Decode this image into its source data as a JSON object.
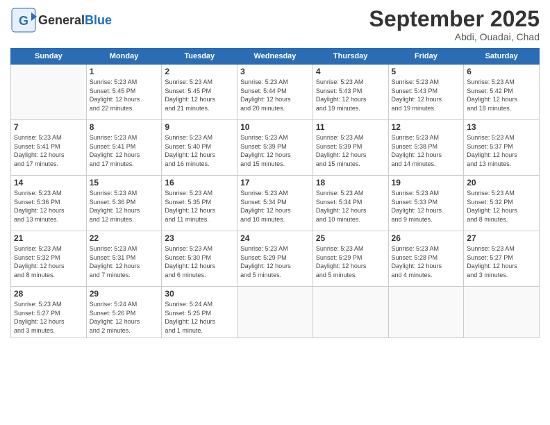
{
  "header": {
    "logo_general": "General",
    "logo_blue": "Blue",
    "month_title": "September 2025",
    "subtitle": "Abdi, Ouadai, Chad"
  },
  "days_of_week": [
    "Sunday",
    "Monday",
    "Tuesday",
    "Wednesday",
    "Thursday",
    "Friday",
    "Saturday"
  ],
  "weeks": [
    [
      {
        "day": "",
        "info": ""
      },
      {
        "day": "1",
        "info": "Sunrise: 5:23 AM\nSunset: 5:45 PM\nDaylight: 12 hours\nand 22 minutes."
      },
      {
        "day": "2",
        "info": "Sunrise: 5:23 AM\nSunset: 5:45 PM\nDaylight: 12 hours\nand 21 minutes."
      },
      {
        "day": "3",
        "info": "Sunrise: 5:23 AM\nSunset: 5:44 PM\nDaylight: 12 hours\nand 20 minutes."
      },
      {
        "day": "4",
        "info": "Sunrise: 5:23 AM\nSunset: 5:43 PM\nDaylight: 12 hours\nand 19 minutes."
      },
      {
        "day": "5",
        "info": "Sunrise: 5:23 AM\nSunset: 5:43 PM\nDaylight: 12 hours\nand 19 minutes."
      },
      {
        "day": "6",
        "info": "Sunrise: 5:23 AM\nSunset: 5:42 PM\nDaylight: 12 hours\nand 18 minutes."
      }
    ],
    [
      {
        "day": "7",
        "info": "Sunrise: 5:23 AM\nSunset: 5:41 PM\nDaylight: 12 hours\nand 17 minutes."
      },
      {
        "day": "8",
        "info": "Sunrise: 5:23 AM\nSunset: 5:41 PM\nDaylight: 12 hours\nand 17 minutes."
      },
      {
        "day": "9",
        "info": "Sunrise: 5:23 AM\nSunset: 5:40 PM\nDaylight: 12 hours\nand 16 minutes."
      },
      {
        "day": "10",
        "info": "Sunrise: 5:23 AM\nSunset: 5:39 PM\nDaylight: 12 hours\nand 15 minutes."
      },
      {
        "day": "11",
        "info": "Sunrise: 5:23 AM\nSunset: 5:39 PM\nDaylight: 12 hours\nand 15 minutes."
      },
      {
        "day": "12",
        "info": "Sunrise: 5:23 AM\nSunset: 5:38 PM\nDaylight: 12 hours\nand 14 minutes."
      },
      {
        "day": "13",
        "info": "Sunrise: 5:23 AM\nSunset: 5:37 PM\nDaylight: 12 hours\nand 13 minutes."
      }
    ],
    [
      {
        "day": "14",
        "info": "Sunrise: 5:23 AM\nSunset: 5:36 PM\nDaylight: 12 hours\nand 13 minutes."
      },
      {
        "day": "15",
        "info": "Sunrise: 5:23 AM\nSunset: 5:36 PM\nDaylight: 12 hours\nand 12 minutes."
      },
      {
        "day": "16",
        "info": "Sunrise: 5:23 AM\nSunset: 5:35 PM\nDaylight: 12 hours\nand 11 minutes."
      },
      {
        "day": "17",
        "info": "Sunrise: 5:23 AM\nSunset: 5:34 PM\nDaylight: 12 hours\nand 10 minutes."
      },
      {
        "day": "18",
        "info": "Sunrise: 5:23 AM\nSunset: 5:34 PM\nDaylight: 12 hours\nand 10 minutes."
      },
      {
        "day": "19",
        "info": "Sunrise: 5:23 AM\nSunset: 5:33 PM\nDaylight: 12 hours\nand 9 minutes."
      },
      {
        "day": "20",
        "info": "Sunrise: 5:23 AM\nSunset: 5:32 PM\nDaylight: 12 hours\nand 8 minutes."
      }
    ],
    [
      {
        "day": "21",
        "info": "Sunrise: 5:23 AM\nSunset: 5:32 PM\nDaylight: 12 hours\nand 8 minutes."
      },
      {
        "day": "22",
        "info": "Sunrise: 5:23 AM\nSunset: 5:31 PM\nDaylight: 12 hours\nand 7 minutes."
      },
      {
        "day": "23",
        "info": "Sunrise: 5:23 AM\nSunset: 5:30 PM\nDaylight: 12 hours\nand 6 minutes."
      },
      {
        "day": "24",
        "info": "Sunrise: 5:23 AM\nSunset: 5:29 PM\nDaylight: 12 hours\nand 5 minutes."
      },
      {
        "day": "25",
        "info": "Sunrise: 5:23 AM\nSunset: 5:29 PM\nDaylight: 12 hours\nand 5 minutes."
      },
      {
        "day": "26",
        "info": "Sunrise: 5:23 AM\nSunset: 5:28 PM\nDaylight: 12 hours\nand 4 minutes."
      },
      {
        "day": "27",
        "info": "Sunrise: 5:23 AM\nSunset: 5:27 PM\nDaylight: 12 hours\nand 3 minutes."
      }
    ],
    [
      {
        "day": "28",
        "info": "Sunrise: 5:23 AM\nSunset: 5:27 PM\nDaylight: 12 hours\nand 3 minutes."
      },
      {
        "day": "29",
        "info": "Sunrise: 5:24 AM\nSunset: 5:26 PM\nDaylight: 12 hours\nand 2 minutes."
      },
      {
        "day": "30",
        "info": "Sunrise: 5:24 AM\nSunset: 5:25 PM\nDaylight: 12 hours\nand 1 minute."
      },
      {
        "day": "",
        "info": ""
      },
      {
        "day": "",
        "info": ""
      },
      {
        "day": "",
        "info": ""
      },
      {
        "day": "",
        "info": ""
      }
    ]
  ]
}
